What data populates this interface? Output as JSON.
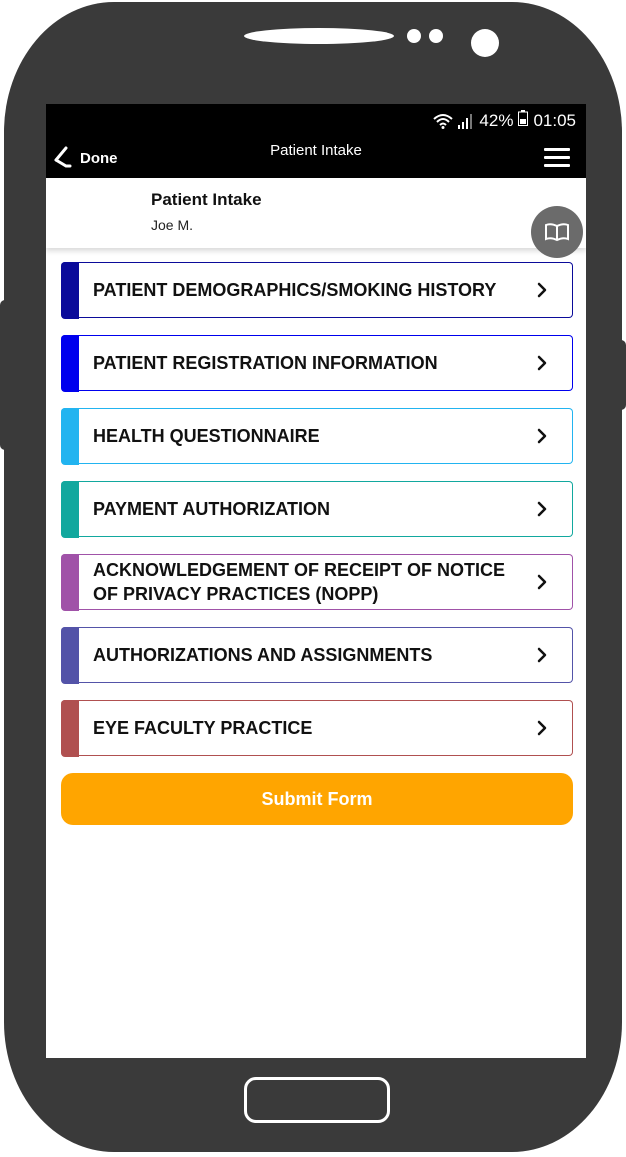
{
  "status": {
    "battery": "42%",
    "time": "01:05"
  },
  "appbar": {
    "back_label": "Done",
    "title": "Patient Intake"
  },
  "header": {
    "title": "Patient Intake",
    "subtitle": "Joe M."
  },
  "sections": [
    {
      "label": "PATIENT DEMOGRAPHICS/SMOKING HISTORY",
      "color": "#0b0b9a"
    },
    {
      "label": "PATIENT REGISTRATION INFORMATION",
      "color": "#0000ee"
    },
    {
      "label": "HEALTH QUESTIONNAIRE",
      "color": "#22b4f0"
    },
    {
      "label": "PAYMENT AUTHORIZATION",
      "color": "#12a89e"
    },
    {
      "label": "ACKNOWLEDGEMENT OF RECEIPT OF NOTICE OF PRIVACY PRACTICES (NOPP)",
      "color": "#a052a8"
    },
    {
      "label": "AUTHORIZATIONS AND ASSIGNMENTS",
      "color": "#5353a8"
    },
    {
      "label": "EYE FACULTY PRACTICE",
      "color": "#b05050"
    }
  ],
  "submit": {
    "label": "Submit Form",
    "color": "#ffa500"
  },
  "icons": {
    "back": "back-chevron-icon",
    "menu": "hamburger-menu-icon",
    "book": "open-book-icon",
    "chevron": "chevron-right-icon",
    "wifi": "wifi-icon",
    "signal": "signal-icon",
    "battery": "battery-icon"
  }
}
